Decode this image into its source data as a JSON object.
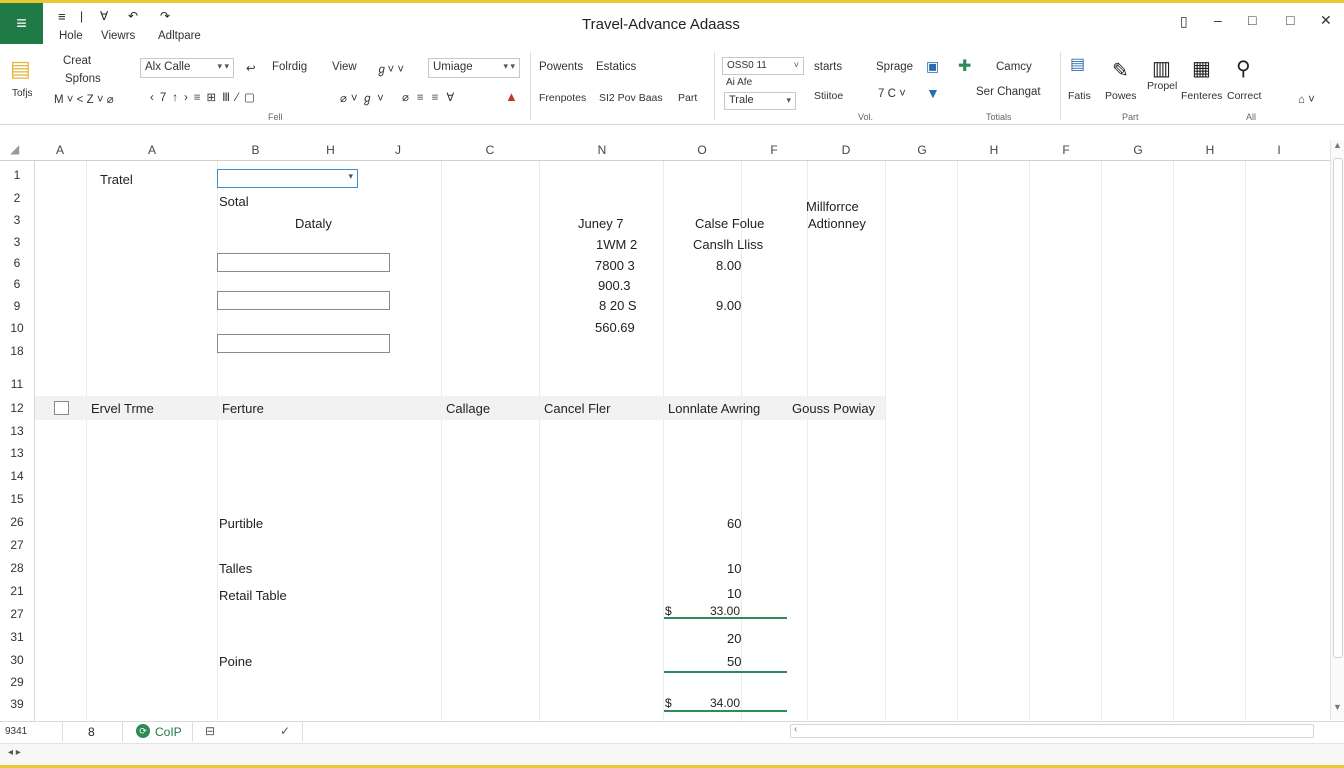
{
  "window": {
    "title": "Travel-Advance Adaass",
    "menu": [
      "Hole",
      "Viewrs",
      "Adltpare"
    ]
  },
  "ribbon": {
    "clipboard": {
      "item1": "Creat",
      "item2": "Spfons",
      "label": "Tofjs"
    },
    "font": {
      "name": "Alx Calle",
      "format_label": "Folrdig",
      "view_label": "View",
      "group_label": "Fell"
    },
    "number": {
      "format": "Umiage"
    },
    "styles": {
      "powents": "Powents",
      "estatics": "Estatics",
      "frenpotes": "Frenpotes",
      "bar": "SI2 Pov Baas",
      "part": "Part"
    },
    "cells": {
      "combo": "OSS0 11",
      "sub": "Ai Afe",
      "table": "Trale",
      "starts": "starts",
      "stitoe": "Stiitoe",
      "spage": "Sprage",
      "volume_label": "Vol."
    },
    "editing": {
      "camcy": "Camcy",
      "ser_changat": "Ser Changat",
      "totals_label": "Totials"
    },
    "analysis": {
      "fatis": "Fatis",
      "powes": "Powes",
      "propel": "Propel",
      "fenteres": "Fenteres",
      "correct": "Correct",
      "part_label": "Part",
      "all_label": "All"
    }
  },
  "columns": [
    "A",
    "A",
    "B",
    "H",
    "J",
    "C",
    "N",
    "O",
    "F",
    "D",
    "G",
    "H",
    "F",
    "G",
    "H",
    "I"
  ],
  "rows": [
    "1",
    "2",
    "3",
    "3",
    "6",
    "6",
    "9",
    "10",
    "18",
    "11",
    "12",
    "13",
    "13",
    "14",
    "15",
    "26",
    "27",
    "28",
    "21",
    "27",
    "31",
    "30",
    "29",
    "39"
  ],
  "sheet": {
    "travel_label": "Tratel",
    "total_label": "Sotal",
    "dataly_label": "Dataly",
    "juney": "Juney 7",
    "calse_folue": "Calse Folue",
    "milliornce": "Millforrce",
    "adtionney": "Adtionney",
    "v1": "1WM 2",
    "canslh": "Canslh Lliss",
    "v2": "7800 3",
    "v3": "8.00",
    "v4": "900.3",
    "v5": "8 20 S",
    "v6": "9.00",
    "v7": "560.69",
    "table_headers": [
      "Ervel Trme",
      "Ferture",
      "Callage",
      "Cancel Fler",
      "Lonnlate Awring",
      "Gouss Powiay"
    ],
    "purtible": "Purtible",
    "p60": "60",
    "talles": "Talles",
    "t10a": "10",
    "retail": "Retail Table",
    "t10b": "10",
    "dollar1": "$",
    "sum1": "33.00",
    "t20": "20",
    "poine": "Poine",
    "t50": "50",
    "dollar2": "$",
    "sum2": "34.00"
  },
  "sheetbar": {
    "namebox": "9341",
    "tab1": "8",
    "tab2": "CoIP"
  },
  "colors": {
    "accent": "#1f7a46",
    "frame": "#e7c933",
    "underline": "#2e8b57"
  }
}
